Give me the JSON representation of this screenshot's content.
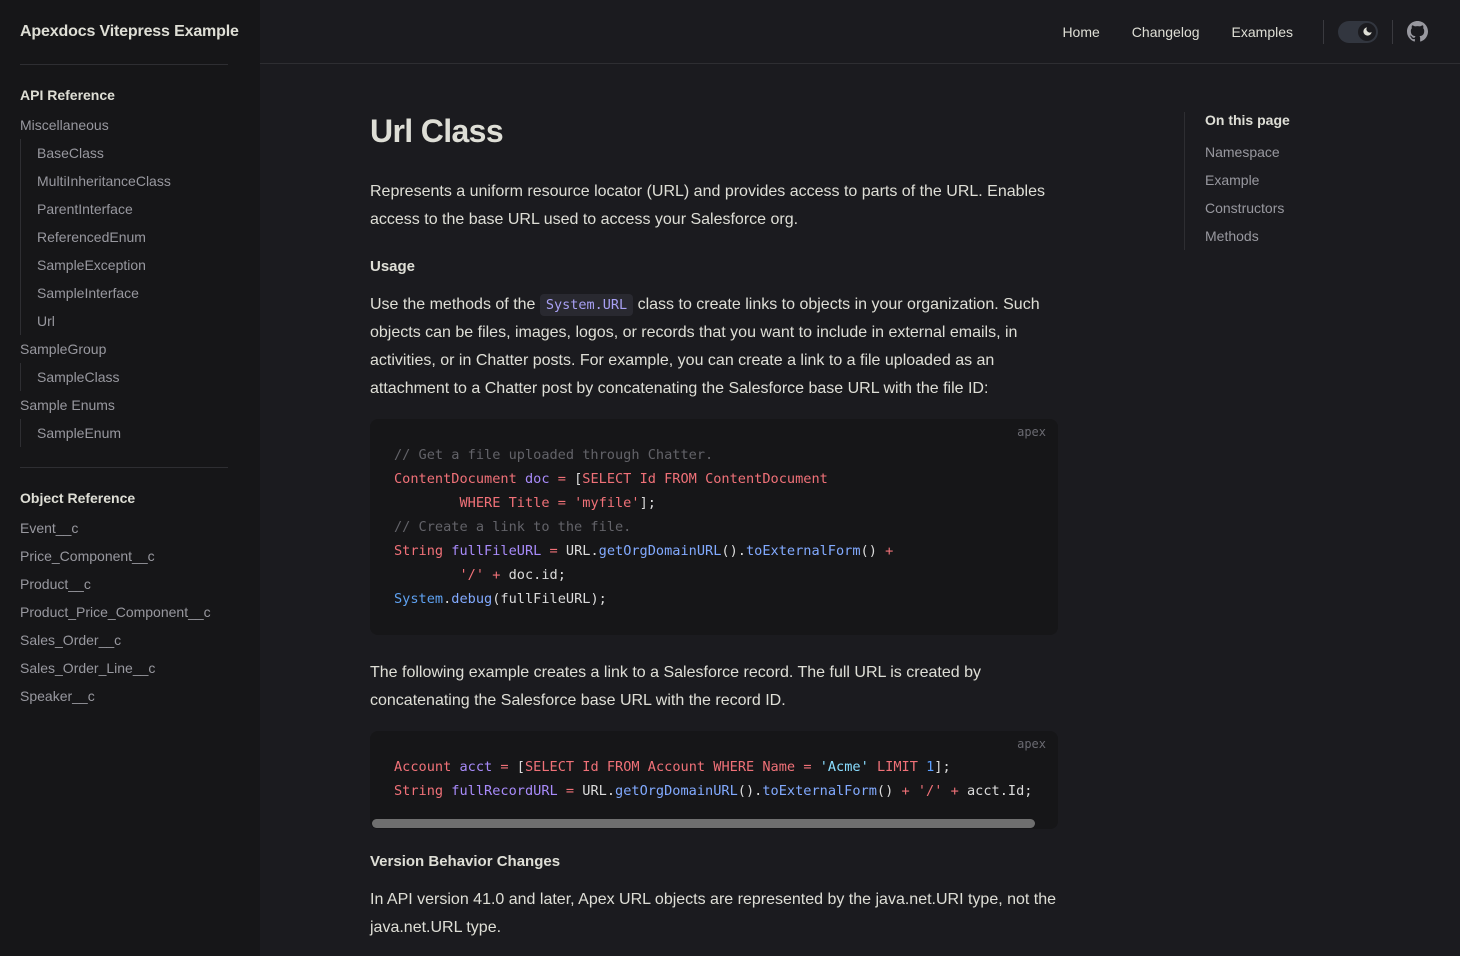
{
  "site": {
    "title": "Apexdocs Vitepress Example"
  },
  "nav": {
    "links": [
      {
        "label": "Home"
      },
      {
        "label": "Changelog"
      },
      {
        "label": "Examples"
      }
    ],
    "appearance_icon": "moon-icon",
    "github_icon": "github-icon"
  },
  "sidebar": {
    "groups": [
      {
        "title": "API Reference",
        "sections": [
          {
            "label": "Miscellaneous",
            "items": [
              {
                "label": "BaseClass"
              },
              {
                "label": "MultiInheritanceClass"
              },
              {
                "label": "ParentInterface"
              },
              {
                "label": "ReferencedEnum"
              },
              {
                "label": "SampleException"
              },
              {
                "label": "SampleInterface"
              },
              {
                "label": "Url"
              }
            ]
          },
          {
            "label": "SampleGroup",
            "items": [
              {
                "label": "SampleClass"
              }
            ]
          },
          {
            "label": "Sample Enums",
            "items": [
              {
                "label": "SampleEnum"
              }
            ]
          }
        ]
      },
      {
        "title": "Object Reference",
        "flat_items": [
          {
            "label": "Event__c"
          },
          {
            "label": "Price_Component__c"
          },
          {
            "label": "Product__c"
          },
          {
            "label": "Product_Price_Component__c"
          },
          {
            "label": "Sales_Order__c"
          },
          {
            "label": "Sales_Order_Line__c"
          },
          {
            "label": "Speaker__c"
          }
        ]
      }
    ]
  },
  "main": {
    "page_title": "Url Class",
    "intro": "Represents a uniform resource locator (URL) and provides access to parts of the URL. Enables access to the base URL used to access your Salesforce org.",
    "usage_heading": "Usage",
    "usage_para_before": "Use the methods of the ",
    "usage_inline_code": "System.URL",
    "usage_para_after": " class to create links to objects in your organization. Such objects can be files, images, logos, or records that you want to include in external emails, in activities, or in Chatter posts. For example, you can create a link to a file uploaded as an attachment to a Chatter post by concatenating the Salesforce base URL with the file ID:",
    "code_block_1": {
      "lang_label": "apex",
      "lines": [
        "// Get a file uploaded through Chatter.",
        "ContentDocument doc = [SELECT Id FROM ContentDocument",
        "        WHERE Title = 'myfile'];",
        "// Create a link to the file.",
        "String fullFileURL = URL.getOrgDomainURL().toExternalForm() +",
        "        '/' + doc.id;",
        "System.debug(fullFileURL);"
      ]
    },
    "example_para": "The following example creates a link to a Salesforce record. The full URL is created by concatenating the Salesforce base URL with the record ID.",
    "code_block_2": {
      "lang_label": "apex",
      "lines": [
        "Account acct = [SELECT Id FROM Account WHERE Name = 'Acme' LIMIT 1];",
        "String fullRecordURL = URL.getOrgDomainURL().toExternalForm() + '/' + acct.Id;"
      ]
    },
    "version_heading": "Version Behavior Changes",
    "version_para": "In API version 41.0 and later, Apex URL objects are represented by the java.net.URI type, not the java.net.URL type."
  },
  "aside": {
    "title": "On this page",
    "links": [
      {
        "label": "Namespace"
      },
      {
        "label": "Example"
      },
      {
        "label": "Constructors"
      },
      {
        "label": "Methods"
      }
    ]
  },
  "colors": {
    "page_bg": "#1b1b1f",
    "sidebar_bg": "#161618",
    "code_bg": "#161618",
    "text": "#fffff5db",
    "muted": "#98989f",
    "divider": "#2e2e32",
    "token_type": "#f07178",
    "token_var": "#a88bfa",
    "token_fn": "#82aaff",
    "token_comment": "#636369",
    "inline_code": "#a8a0f3"
  }
}
